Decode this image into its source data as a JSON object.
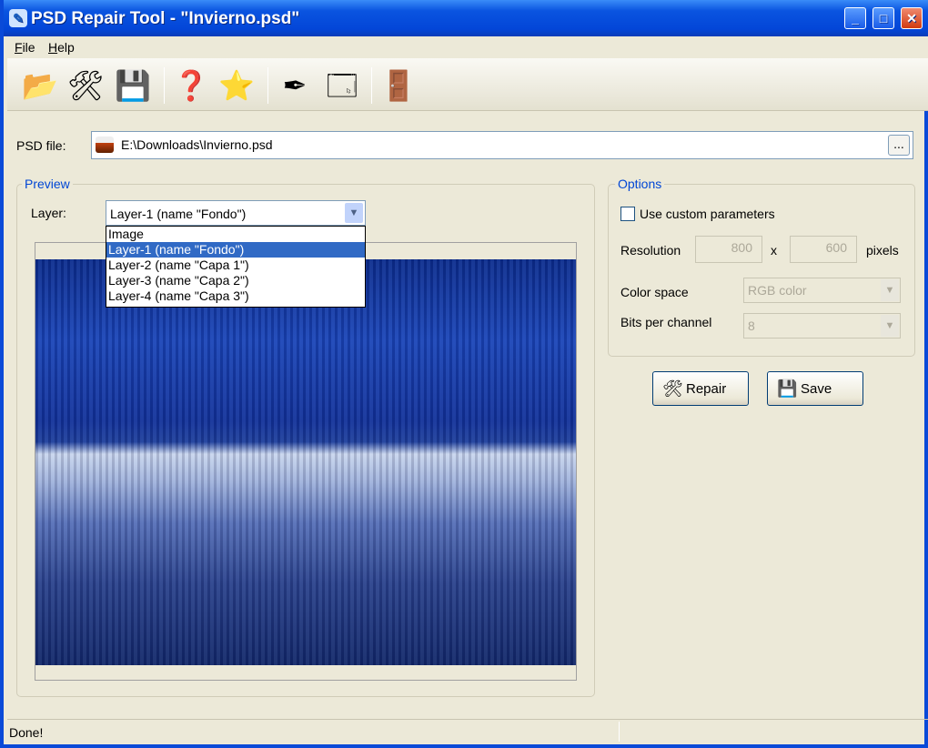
{
  "window": {
    "title": "PSD Repair Tool - \"Invierno.psd\"",
    "minimize": "_",
    "maximize": "□",
    "close": "✕"
  },
  "menu": {
    "file": "File",
    "help": "Help"
  },
  "toolbar": [
    {
      "name": "open-folder-icon",
      "glyph": "📂"
    },
    {
      "name": "tools-icon",
      "glyph": "🛠"
    },
    {
      "name": "save-disk-icon",
      "glyph": "💾"
    },
    {
      "name": "help-icon",
      "glyph": "❓"
    },
    {
      "name": "star-icon",
      "glyph": "⭐"
    },
    {
      "name": "edit-pen-icon",
      "glyph": "✒"
    },
    {
      "name": "window-icon",
      "glyph": "🗔"
    },
    {
      "name": "exit-door-icon",
      "glyph": "🚪"
    }
  ],
  "psd_file": {
    "label": "PSD file:",
    "value": "E:\\Downloads\\Invierno.psd",
    "browse": "..."
  },
  "preview": {
    "title": "Preview",
    "layer_label": "Layer:",
    "layer_selected": "Layer-1 (name \"Fondo\")",
    "options": [
      "Image",
      "Layer-1 (name \"Fondo\")",
      "Layer-2 (name \"Capa 1\")",
      "Layer-3 (name \"Capa 2\")",
      "Layer-4 (name \"Capa 3\")"
    ]
  },
  "options": {
    "title": "Options",
    "custom_label": "Use custom parameters",
    "custom_checked": false,
    "resolution_label": "Resolution",
    "width": "800",
    "x": "x",
    "height": "600",
    "pixels": "pixels",
    "color_space_label": "Color space",
    "color_space": "RGB color",
    "bits_label": "Bits per channel",
    "bits": "8"
  },
  "buttons": {
    "repair": "Repair",
    "save": "Save"
  },
  "status": {
    "text": "Done!"
  }
}
